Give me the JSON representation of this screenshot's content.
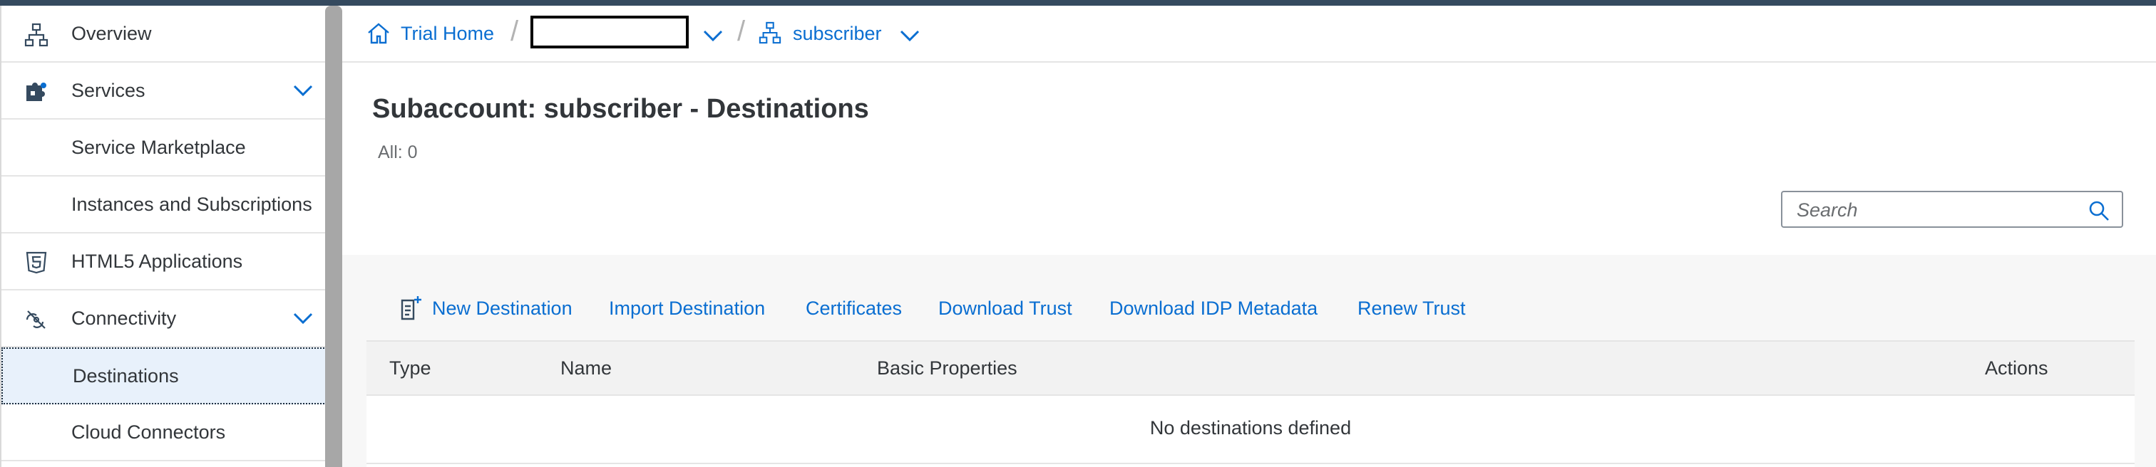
{
  "sidebar": {
    "items": [
      {
        "label": "Overview",
        "icon": "org-chart-icon"
      },
      {
        "label": "Services",
        "icon": "puzzle-icon",
        "expandable": true
      },
      {
        "label": "Service Marketplace"
      },
      {
        "label": "Instances and Subscriptions"
      },
      {
        "label": "HTML5 Applications",
        "icon": "html5-icon"
      },
      {
        "label": "Connectivity",
        "icon": "connectivity-icon",
        "expandable": true
      },
      {
        "label": "Destinations",
        "selected": true
      },
      {
        "label": "Cloud Connectors"
      }
    ]
  },
  "breadcrumb": {
    "home_label": "Trial Home",
    "separator": "/",
    "subaccount_label": "subscriber"
  },
  "page": {
    "title": "Subaccount: subscriber - Destinations",
    "count": "All: 0"
  },
  "search": {
    "placeholder": "Search",
    "value": ""
  },
  "toolbar": {
    "new_destination": "New Destination",
    "import_destination": "Import Destination",
    "certificates": "Certificates",
    "download_trust": "Download Trust",
    "download_idp_metadata": "Download IDP Metadata",
    "renew_trust": "Renew Trust"
  },
  "table": {
    "columns": [
      "Type",
      "Name",
      "Basic Properties",
      "Actions"
    ],
    "empty_text": "No destinations defined"
  },
  "colors": {
    "link": "#0a6ed1",
    "shell": "#354a5f",
    "selected_bg": "#e8f1fb",
    "text": "#32363a"
  }
}
